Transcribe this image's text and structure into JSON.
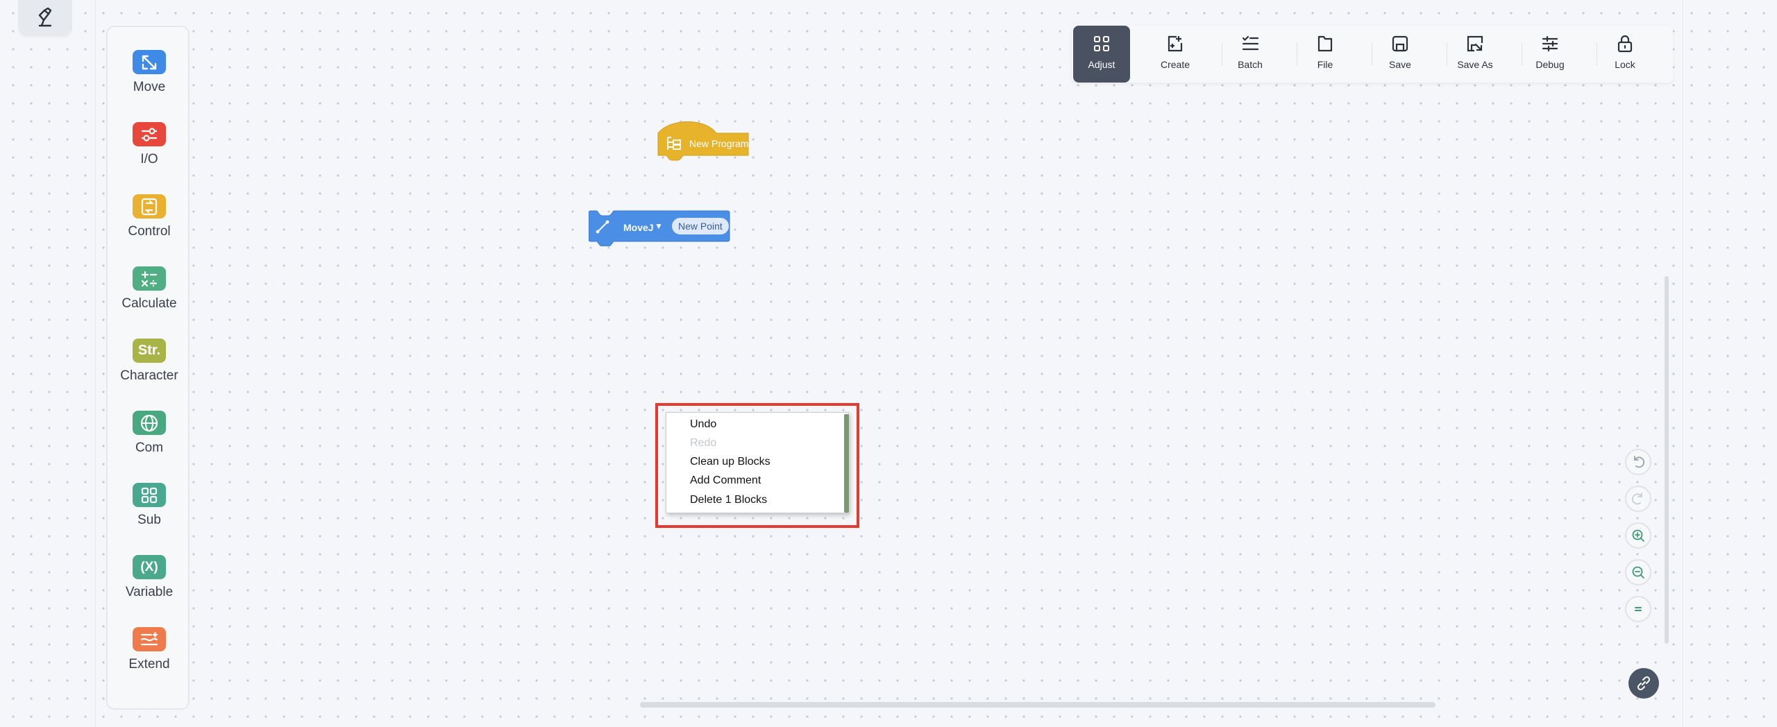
{
  "categories": [
    {
      "label": "Move",
      "icon": "move-arrows-icon",
      "color": "#3f8ae6"
    },
    {
      "label": "I/O",
      "icon": "io-sliders-icon",
      "color": "#e8473b"
    },
    {
      "label": "Control",
      "icon": "control-icon",
      "color": "#e9b12f"
    },
    {
      "label": "Calculate",
      "icon": "calculate-icon",
      "color": "#4fae83"
    },
    {
      "label": "Character",
      "icon_text": "Str.",
      "icon": "character-icon",
      "color": "#a9b447"
    },
    {
      "label": "Com",
      "icon": "globe-icon",
      "color": "#48a880"
    },
    {
      "label": "Sub",
      "icon": "grid-icon",
      "color": "#48a890"
    },
    {
      "label": "Variable",
      "icon_text": "(X)",
      "icon": "variable-icon",
      "color": "#4aa98a"
    },
    {
      "label": "Extend",
      "icon": "extend-icon",
      "color": "#ef7b4d"
    }
  ],
  "toolbar": [
    {
      "label": "Adjust",
      "icon": "adjust-grid-icon",
      "active": true
    },
    {
      "label": "Create",
      "icon": "create-icon"
    },
    {
      "label": "Batch",
      "icon": "batch-icon"
    },
    {
      "label": "File",
      "icon": "file-icon"
    },
    {
      "label": "Save",
      "icon": "save-icon"
    },
    {
      "label": "Save As",
      "icon": "save-as-icon"
    },
    {
      "label": "Debug",
      "icon": "debug-icon"
    },
    {
      "label": "Lock",
      "icon": "lock-icon"
    }
  ],
  "blocks": {
    "hat": {
      "label": "New Program",
      "color": "#e6b32a"
    },
    "move": {
      "command": "MoveJ",
      "point": "New Point",
      "color": "#4a8ee6"
    }
  },
  "context_menu": {
    "items": [
      {
        "label": "Undo",
        "enabled": true
      },
      {
        "label": "Redo",
        "enabled": false
      },
      {
        "label": "Clean up Blocks",
        "enabled": true
      },
      {
        "label": "Add Comment",
        "enabled": true
      },
      {
        "label": "Delete 1 Blocks",
        "enabled": true
      }
    ]
  },
  "view_controls": [
    "undo-icon",
    "redo-icon",
    "zoom-in-icon",
    "zoom-out-icon",
    "reset-zoom-icon"
  ]
}
